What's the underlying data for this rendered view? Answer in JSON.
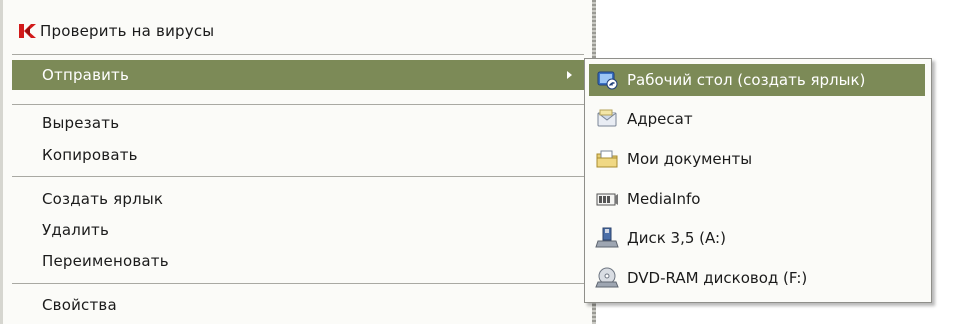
{
  "context_menu": {
    "items": [
      {
        "label": "Проверить на вирусы",
        "icon": "kaspersky-icon"
      },
      {
        "label": "Отправить",
        "has_submenu": true,
        "highlighted": true
      },
      {
        "label": "Вырезать"
      },
      {
        "label": "Копировать"
      },
      {
        "label": "Создать ярлык"
      },
      {
        "label": "Удалить"
      },
      {
        "label": "Переименовать"
      },
      {
        "label": "Свойства"
      }
    ]
  },
  "send_to_submenu": {
    "items": [
      {
        "label": "Рабочий стол (создать ярлык)",
        "icon": "desktop-icon",
        "highlighted": true
      },
      {
        "label": "Адресат",
        "icon": "mail-recipient-icon"
      },
      {
        "label": "Мои документы",
        "icon": "my-documents-icon"
      },
      {
        "label": "MediaInfo",
        "icon": "mediainfo-icon"
      },
      {
        "label": "Диск 3,5 (A:)",
        "icon": "floppy-drive-icon"
      },
      {
        "label": "DVD-RAM дисковод (F:)",
        "icon": "dvd-drive-icon"
      }
    ]
  },
  "colors": {
    "highlight": "#7c8a57",
    "menu_background": "#fbfbf8",
    "text": "#1b1b1b",
    "separator": "#a9a9a3"
  }
}
